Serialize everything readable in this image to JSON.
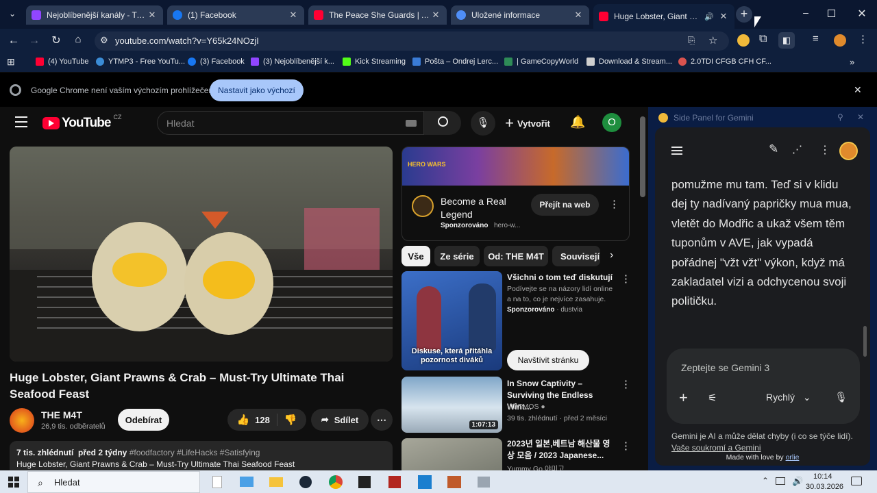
{
  "tabs": [
    {
      "title": "Nejoblíbenější kanály - Twitch",
      "color": "#9146ff"
    },
    {
      "title": "(1) Facebook",
      "color": "#1877f2"
    },
    {
      "title": "The Peace She Guards | Ambien",
      "color": "#ff0033"
    },
    {
      "title": "Uložené informace",
      "color": "#4f8ef7"
    },
    {
      "title": "Huge Lobster, Giant Prawns",
      "color": "#ff0033"
    }
  ],
  "address": {
    "url": "youtube.com/watch?v=Y65k24NOzjI"
  },
  "bookmarks": [
    {
      "label": "(4) YouTube",
      "color": "#ff0033"
    },
    {
      "label": "YTMP3 - Free YouTu...",
      "color": "#3b8cd6"
    },
    {
      "label": "(3) Facebook",
      "color": "#1877f2"
    },
    {
      "label": "(3) Nejoblíbenější k...",
      "color": "#9146ff"
    },
    {
      "label": "Kick Streaming",
      "color": "#53fc18"
    },
    {
      "label": "Pošta – Ondrej Lerc...",
      "color": "#3a7bd5"
    },
    {
      "label": "| GameCopyWorld",
      "color": "#2e8b57"
    },
    {
      "label": "Download & Stream...",
      "color": "#ffffff"
    },
    {
      "label": "2.0TDI CFGB CFH CF...",
      "color": "#d9534f"
    }
  ],
  "infobar": {
    "message": "Google Chrome není vaším výchozím prohlížečem",
    "button": "Nastavit jako výchozí"
  },
  "youtube": {
    "logo": "YouTube",
    "country": "CZ",
    "search_placeholder": "Hledat",
    "create": "Vytvořit",
    "avatar": "O",
    "video_title": "Huge Lobster, Giant Prawns & Crab – Must-Try Ultimate Thai Seafood Feast",
    "channel": "THE M4T",
    "subs": "26,9 tis. odběratelů",
    "subscribe": "Odebírat",
    "likes": "128",
    "share": "Sdílet",
    "desc_stats": "7 tis. zhlédnutí  před 2 týdny",
    "desc_tags": "#foodfactory #LifeHacks #Satisfying",
    "desc_line": "Huge Lobster, Giant Prawns & Crab – Must-Try Ultimate Thai Seafood Feast",
    "ad": {
      "title": "Become a Real Legend",
      "sponsor": "Sponzorováno",
      "domain": "hero-w...",
      "button": "Přejít na web",
      "banner": "HERO WARS"
    },
    "chips": [
      "Vše",
      "Ze série",
      "Od: THE M4T",
      "Souvisejí"
    ],
    "recs": [
      {
        "title": "Všichni o tom teď diskutují",
        "sub": "Podívejte se na názory lidí online a na to, co je nejvíce zasahuje.",
        "sponsor": "Sponzorováno",
        "channel": "dustvia",
        "thumb_text": "Diskuse, která přitáhla pozornost diváků",
        "button": "Navštívit stránku"
      },
      {
        "title": "In Snow Captivity – Surviving the Endless Wint...",
        "channel": "VIATMOS",
        "stats": "39 tis. zhlédnutí · před 2 měsíci",
        "duration": "1:07:13"
      },
      {
        "title": "2023년 일본,베트남 해산물 영상 모음 / 2023 Japanese...",
        "channel": "Yummy Go 야미고"
      }
    ]
  },
  "gemini": {
    "panel_title": "Side Panel for Gemini",
    "text": "pomužme mu tam. Teď si v klidu dej ty nadívaný papričky mua mua, vletět do Modřic a ukaž všem těm tuponům v AVE, jak vypadá pořádnej \"vžt vžt\" výkon, když má zakladatel vizi a odchycenou svoji političku.",
    "input_placeholder": "Zeptejte se Gemini 3",
    "mode": "Rychlý",
    "disclaimer": "Gemini je AI a může dělat chyby (i co se týče lidí).",
    "privacy_link": "Vaše soukromí a Gemini",
    "made_prefix": "Made with love by",
    "made_by": "orlie"
  },
  "taskbar": {
    "search": "Hledat",
    "time": "10:14",
    "date": "30.03.2026"
  }
}
